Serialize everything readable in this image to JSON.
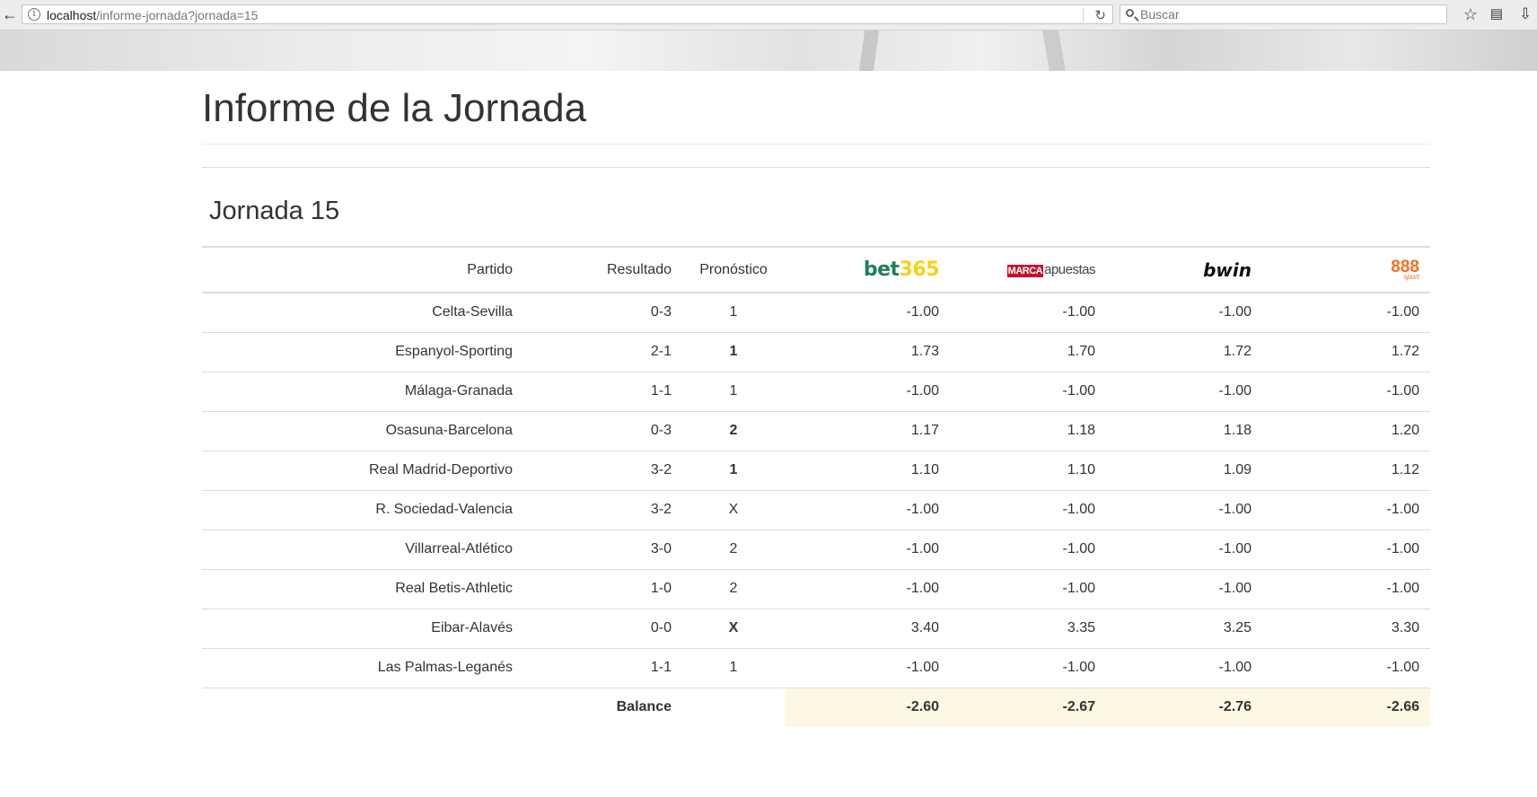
{
  "browser": {
    "url_host": "localhost",
    "url_path": "/informe-jornada?jornada=15",
    "search_placeholder": "Buscar"
  },
  "page": {
    "title": "Informe de la Jornada",
    "subtitle": "Jornada 15"
  },
  "table": {
    "headers": {
      "partido": "Partido",
      "resultado": "Resultado",
      "pronostico": "Pronóstico"
    },
    "bookmakers": {
      "bet365": {
        "part1": "bet",
        "part2": "365"
      },
      "marca": {
        "part1": "MARCA",
        "part2": "apuestas"
      },
      "bwin": "bwin",
      "sport888": {
        "number": "888",
        "label": "sport"
      }
    },
    "rows": [
      {
        "partido": "Celta-Sevilla",
        "resultado": "0-3",
        "pronostico": "1",
        "bet365": "-1.00",
        "marca": "-1.00",
        "bwin": "-1.00",
        "sport888": "-1.00"
      },
      {
        "partido": "Espanyol-Sporting",
        "resultado": "2-1",
        "pronostico": "1",
        "bet365": "1.73",
        "marca": "1.70",
        "bwin": "1.72",
        "sport888": "1.72"
      },
      {
        "partido": "Málaga-Granada",
        "resultado": "1-1",
        "pronostico": "1",
        "bet365": "-1.00",
        "marca": "-1.00",
        "bwin": "-1.00",
        "sport888": "-1.00"
      },
      {
        "partido": "Osasuna-Barcelona",
        "resultado": "0-3",
        "pronostico": "2",
        "bet365": "1.17",
        "marca": "1.18",
        "bwin": "1.18",
        "sport888": "1.20"
      },
      {
        "partido": "Real Madrid-Deportivo",
        "resultado": "3-2",
        "pronostico": "1",
        "bet365": "1.10",
        "marca": "1.10",
        "bwin": "1.09",
        "sport888": "1.12"
      },
      {
        "partido": "R. Sociedad-Valencia",
        "resultado": "3-2",
        "pronostico": "X",
        "bet365": "-1.00",
        "marca": "-1.00",
        "bwin": "-1.00",
        "sport888": "-1.00"
      },
      {
        "partido": "Villarreal-Atlético",
        "resultado": "3-0",
        "pronostico": "2",
        "bet365": "-1.00",
        "marca": "-1.00",
        "bwin": "-1.00",
        "sport888": "-1.00"
      },
      {
        "partido": "Real Betis-Athletic",
        "resultado": "1-0",
        "pronostico": "2",
        "bet365": "-1.00",
        "marca": "-1.00",
        "bwin": "-1.00",
        "sport888": "-1.00"
      },
      {
        "partido": "Eibar-Alavés",
        "resultado": "0-0",
        "pronostico": "X",
        "bet365": "3.40",
        "marca": "3.35",
        "bwin": "3.25",
        "sport888": "3.30"
      },
      {
        "partido": "Las Palmas-Leganés",
        "resultado": "1-1",
        "pronostico": "1",
        "bet365": "-1.00",
        "marca": "-1.00",
        "bwin": "-1.00",
        "sport888": "-1.00"
      }
    ],
    "balance": {
      "label": "Balance",
      "bet365": "-2.60",
      "marca": "-2.67",
      "bwin": "-2.76",
      "sport888": "-2.66"
    }
  }
}
